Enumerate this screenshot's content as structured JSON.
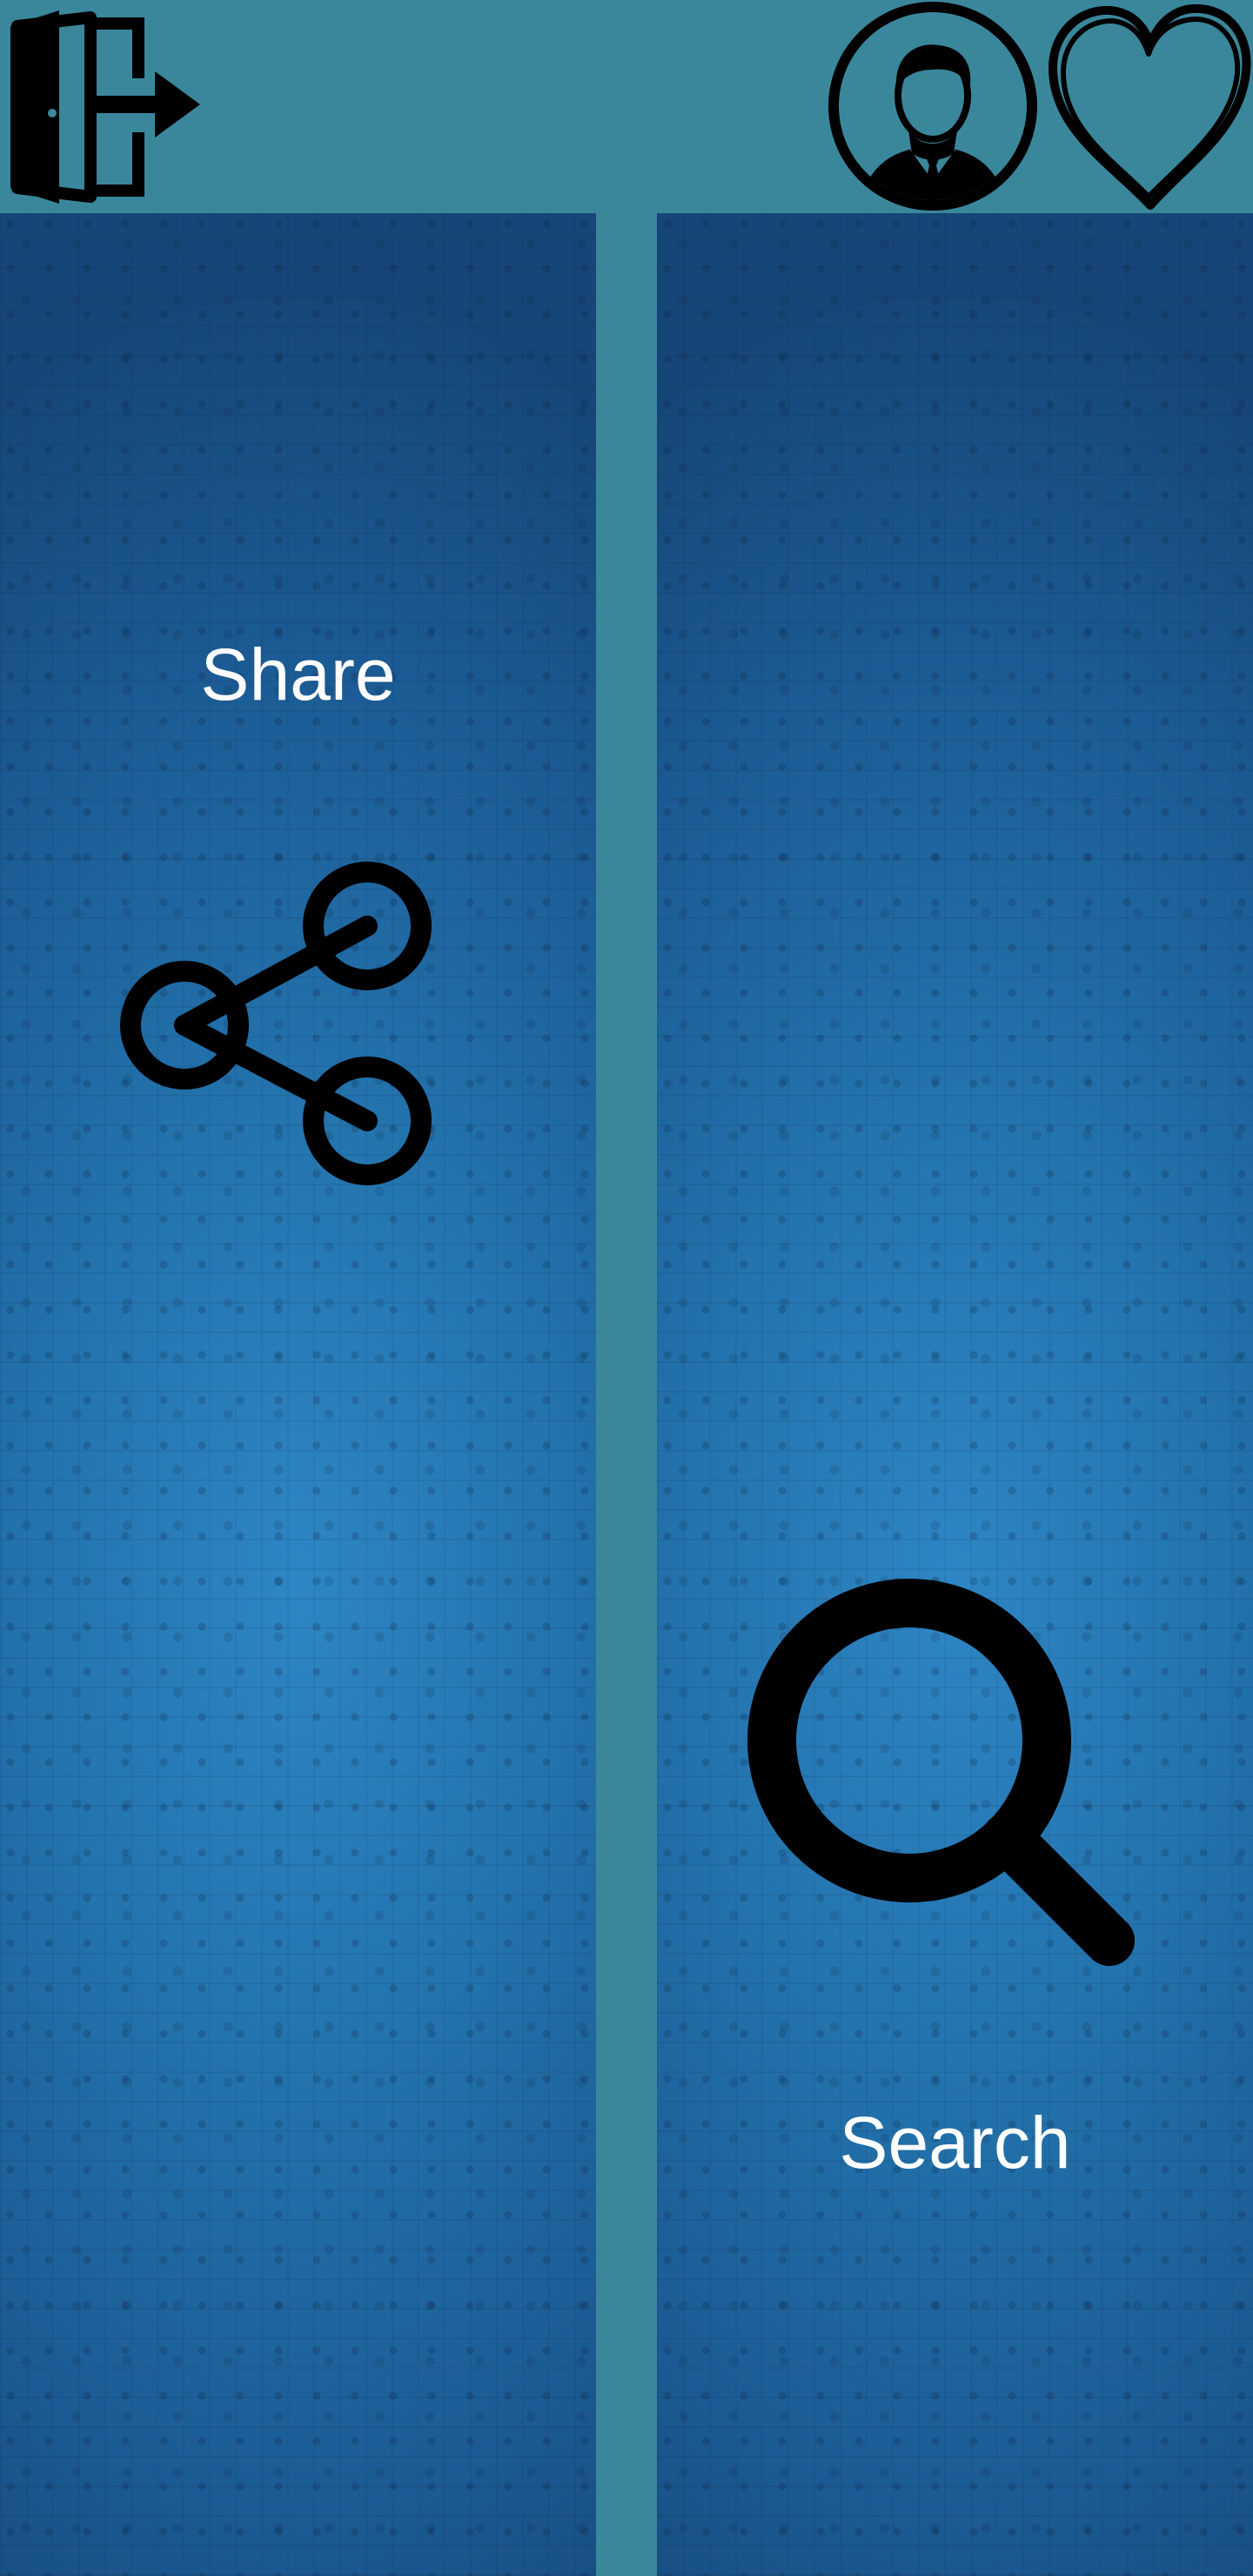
{
  "topbar": {
    "logout_icon": "logout-door-arrow-icon",
    "profile_icon": "user-profile-icon",
    "favorites_icon": "heart-icon"
  },
  "panels": {
    "share": {
      "label": "Share",
      "icon": "share-icon"
    },
    "search": {
      "label": "Search",
      "icon": "search-magnifier-icon"
    }
  },
  "colors": {
    "frame": "#3a879c",
    "panel_center": "#2e86c4",
    "panel_edge": "#164677",
    "icon": "#000000",
    "label": "#ffffff"
  }
}
